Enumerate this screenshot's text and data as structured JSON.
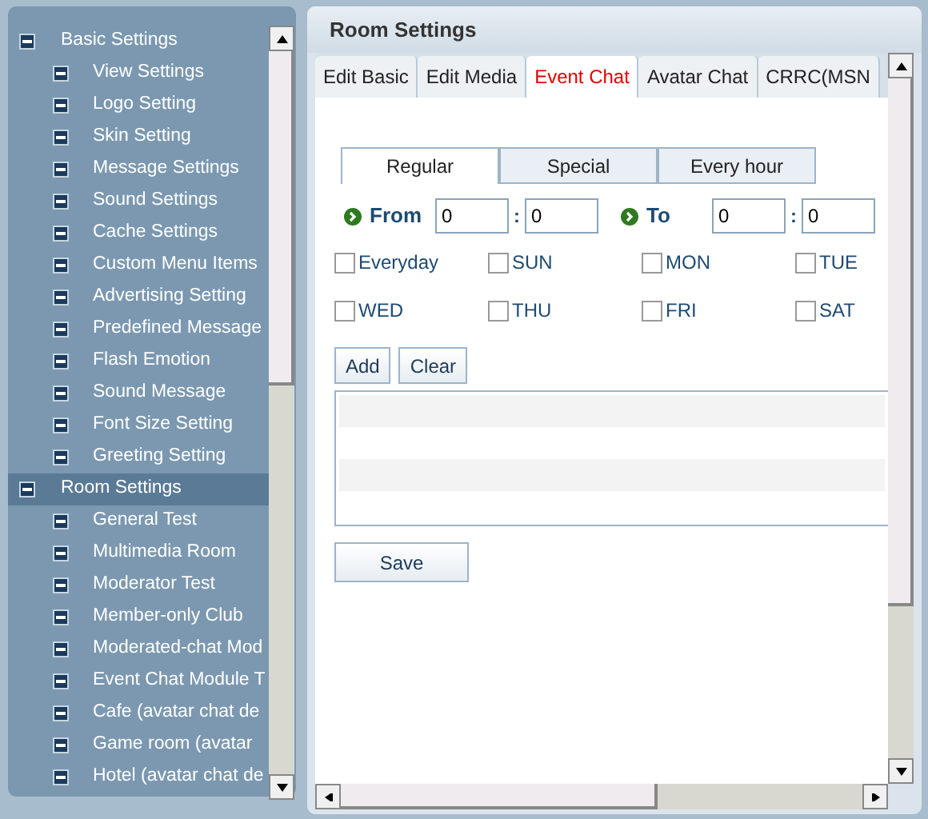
{
  "tree": [
    {
      "label": "Basic Settings",
      "selected": false,
      "children": [
        {
          "label": "View Settings",
          "selected": false
        },
        {
          "label": "Logo Setting",
          "selected": false
        },
        {
          "label": "Skin Setting",
          "selected": false
        },
        {
          "label": "Message Settings",
          "selected": false
        },
        {
          "label": "Sound Settings",
          "selected": false
        },
        {
          "label": "Cache Settings",
          "selected": false
        },
        {
          "label": "Custom Menu Items",
          "selected": false
        },
        {
          "label": "Advertising Setting",
          "selected": false
        },
        {
          "label": "Predefined Message",
          "selected": false
        },
        {
          "label": "Flash Emotion",
          "selected": false
        },
        {
          "label": "Sound Message",
          "selected": false
        },
        {
          "label": "Font Size Setting",
          "selected": false
        },
        {
          "label": "Greeting Setting",
          "selected": false
        }
      ]
    },
    {
      "label": "Room Settings",
      "selected": true,
      "children": [
        {
          "label": "General Test",
          "selected": false
        },
        {
          "label": "Multimedia Room",
          "selected": false
        },
        {
          "label": "Moderator Test",
          "selected": false
        },
        {
          "label": "Member-only Club",
          "selected": false
        },
        {
          "label": "Moderated-chat Mod",
          "selected": false
        },
        {
          "label": "Event Chat Module T",
          "selected": false
        },
        {
          "label": "Cafe (avatar chat de",
          "selected": false
        },
        {
          "label": "Game room (avatar",
          "selected": false
        },
        {
          "label": "Hotel (avatar chat de",
          "selected": false
        }
      ]
    }
  ],
  "panel": {
    "title": "Room Settings",
    "tabs": [
      {
        "label": "Edit Basic",
        "selected": false
      },
      {
        "label": "Edit Media",
        "selected": false
      },
      {
        "label": "Event Chat",
        "selected": true
      },
      {
        "label": "Avatar Chat",
        "selected": false
      },
      {
        "label": "CRRC(MSN",
        "selected": false
      }
    ],
    "subtabs": [
      {
        "label": "Regular",
        "selected": true
      },
      {
        "label": "Special",
        "selected": false
      },
      {
        "label": "Every hour",
        "selected": false
      }
    ],
    "from": {
      "label": "From",
      "hour": "0",
      "minute": "0"
    },
    "to": {
      "label": "To",
      "hour": "0",
      "minute": "0"
    },
    "separator": ":",
    "days": [
      {
        "label": "Everyday",
        "checked": false
      },
      {
        "label": "SUN",
        "checked": false
      },
      {
        "label": "MON",
        "checked": false
      },
      {
        "label": "TUE",
        "checked": false
      },
      {
        "label": "WED",
        "checked": false
      },
      {
        "label": "THU",
        "checked": false
      },
      {
        "label": "FRI",
        "checked": false
      },
      {
        "label": "SAT",
        "checked": false
      }
    ],
    "buttons": [
      "Add",
      "Clear"
    ],
    "save": "Save"
  }
}
